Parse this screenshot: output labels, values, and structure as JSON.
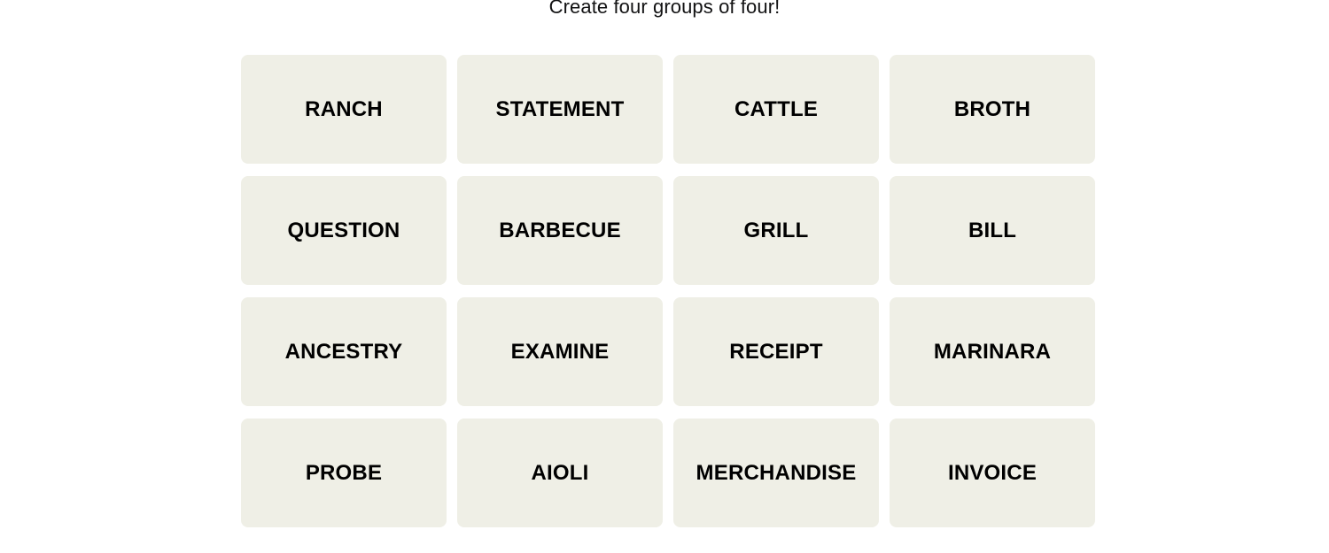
{
  "header": {
    "instruction": "Create four groups of four!"
  },
  "theme": {
    "page_background": "#ffffff",
    "tile_background": "#efefe6",
    "tile_text_color": "#000000",
    "title_text_color": "#121213"
  },
  "board": {
    "rows": 4,
    "columns": 4,
    "tiles": [
      {
        "label": "RANCH"
      },
      {
        "label": "STATEMENT"
      },
      {
        "label": "CATTLE"
      },
      {
        "label": "BROTH"
      },
      {
        "label": "QUESTION"
      },
      {
        "label": "BARBECUE"
      },
      {
        "label": "GRILL"
      },
      {
        "label": "BILL"
      },
      {
        "label": "ANCESTRY"
      },
      {
        "label": "EXAMINE"
      },
      {
        "label": "RECEIPT"
      },
      {
        "label": "MARINARA"
      },
      {
        "label": "PROBE"
      },
      {
        "label": "AIOLI"
      },
      {
        "label": "MERCHANDISE"
      },
      {
        "label": "INVOICE"
      }
    ]
  }
}
